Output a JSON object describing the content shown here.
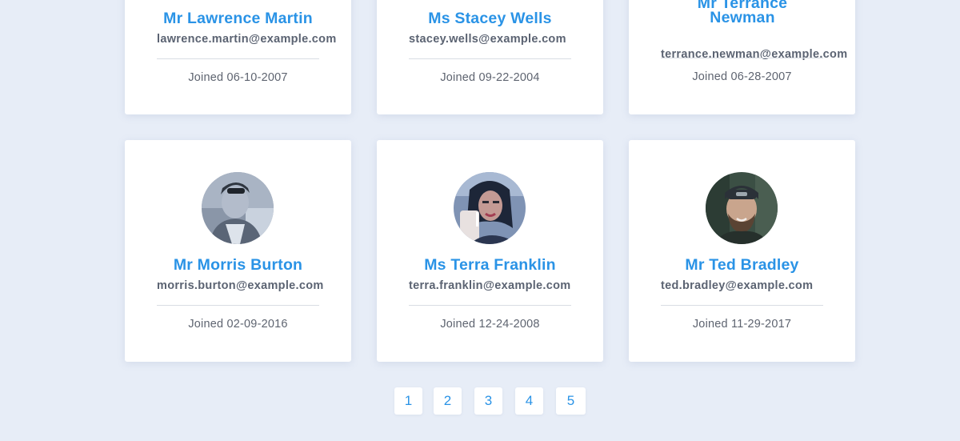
{
  "users": [
    {
      "name": "Mr Lawrence Martin",
      "email": "lawrence.martin@example.com",
      "joined": "Joined 06-10-2007"
    },
    {
      "name": "Ms Stacey Wells",
      "email": "stacey.wells@example.com",
      "joined": "Joined 09-22-2004"
    },
    {
      "name_line1": "Mr Terrance",
      "name_line2": "Newman",
      "email": "terrance.newman@example.com",
      "joined": "Joined 06-28-2007"
    },
    {
      "name": "Mr Morris Burton",
      "email": "morris.burton@example.com",
      "joined": "Joined 02-09-2016"
    },
    {
      "name": "Ms Terra Franklin",
      "email": "terra.franklin@example.com",
      "joined": "Joined 12-24-2008"
    },
    {
      "name": "Mr Ted Bradley",
      "email": "ted.bradley@example.com",
      "joined": "Joined 11-29-2017"
    }
  ],
  "pagination": {
    "pages": [
      "1",
      "2",
      "3",
      "4",
      "5"
    ]
  },
  "colors": {
    "background": "#e7edf7",
    "accent": "#2a93e6",
    "text_muted": "#5e6470"
  }
}
